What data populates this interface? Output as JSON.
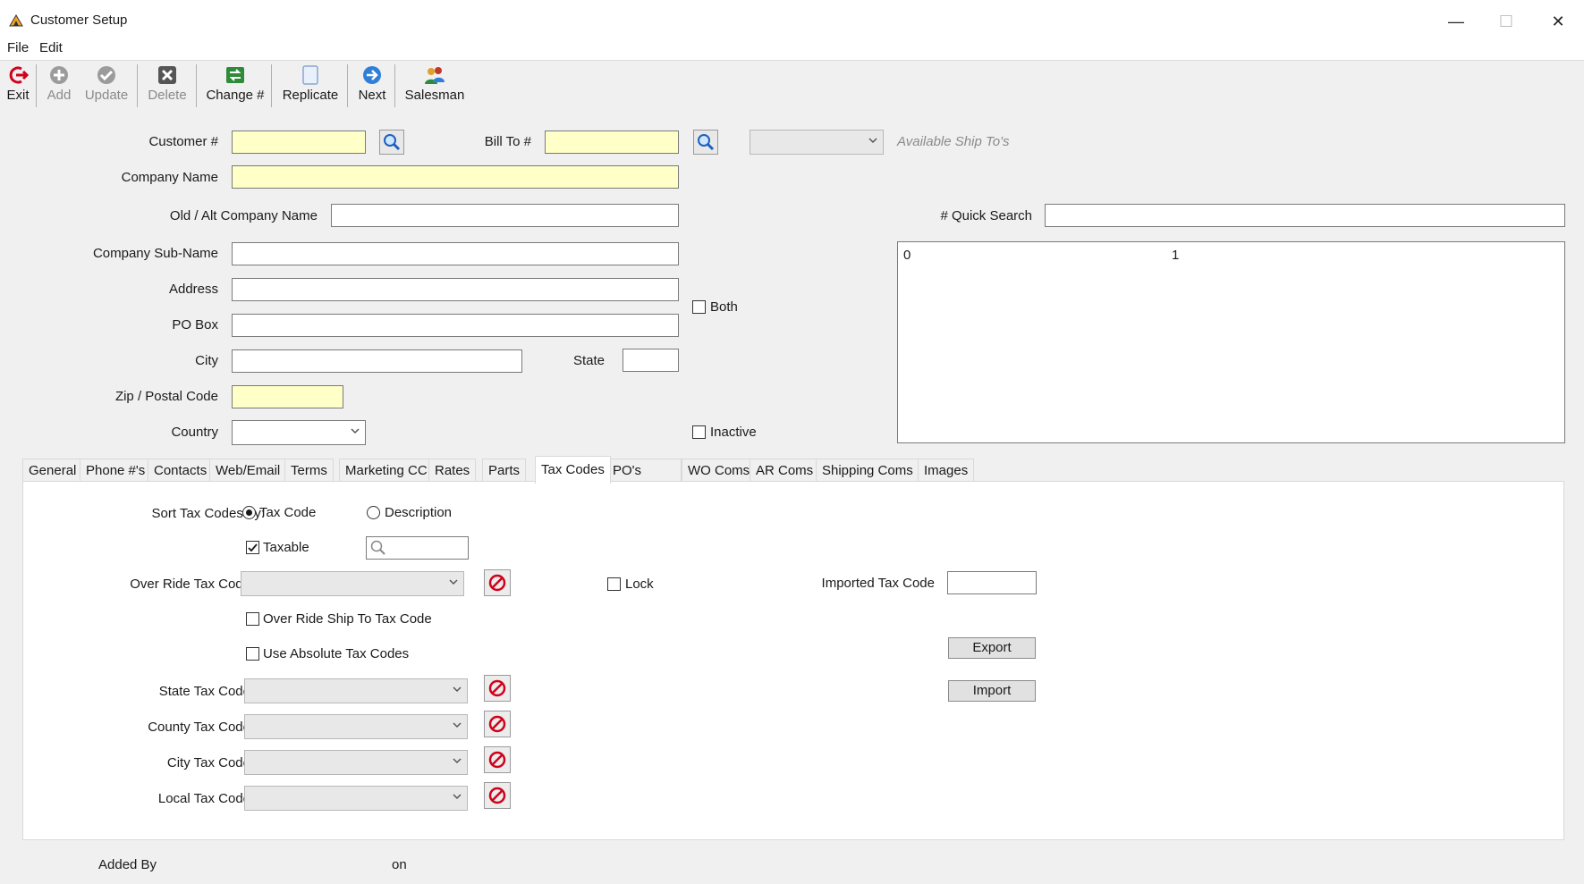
{
  "window": {
    "title": "Customer Setup",
    "minimize": "—",
    "maximize": "☐",
    "close": "✕"
  },
  "menu": {
    "file": "File",
    "edit": "Edit"
  },
  "toolbar": {
    "exit": "Exit",
    "add": "Add",
    "update": "Update",
    "delete": "Delete",
    "change": "Change #",
    "replicate": "Replicate",
    "next": "Next",
    "salesman": "Salesman"
  },
  "form": {
    "customer_label": "Customer #",
    "bill_to_label": "Bill To #",
    "available_ship_tos": "Available Ship To's",
    "company_name_label": "Company Name",
    "old_alt_label": "Old / Alt Company Name",
    "quick_search_label": "# Quick Search",
    "sub_name_label": "Company Sub-Name",
    "address_label": "Address",
    "po_box_label": "PO Box",
    "both_label": "Both",
    "city_label": "City",
    "state_label": "State",
    "zip_label": "Zip / Postal Code",
    "country_label": "Country",
    "inactive_label": "Inactive"
  },
  "quick_list": {
    "col0": "0",
    "col1": "1"
  },
  "tabs": [
    "General",
    "Phone #'s",
    "Contacts",
    "Web/Email",
    "Terms",
    "Marketing CC",
    "Rates",
    "Parts",
    "Tax Codes",
    "PO's",
    "WO Coms",
    "AR Coms",
    "Shipping Coms",
    "Images"
  ],
  "tax": {
    "sort_label": "Sort Tax Codes by:",
    "sort_tax_code": "Tax Code",
    "sort_description": "Description",
    "taxable_label": "Taxable",
    "override_label": "Over Ride Tax Code",
    "lock_label": "Lock",
    "imported_label": "Imported Tax Code",
    "override_ship_label": "Over Ride Ship To Tax Code",
    "absolute_label": "Use Absolute Tax Codes",
    "export_btn": "Export",
    "import_btn": "Import",
    "state_label": "State Tax Code",
    "county_label": "County Tax Code",
    "city_label": "City Tax Code",
    "local_label": "Local Tax Code"
  },
  "footer": {
    "added_by": "Added By",
    "on": "on"
  },
  "colors": {
    "required_field": "#ffffc8",
    "accent_red": "#d0021b"
  }
}
